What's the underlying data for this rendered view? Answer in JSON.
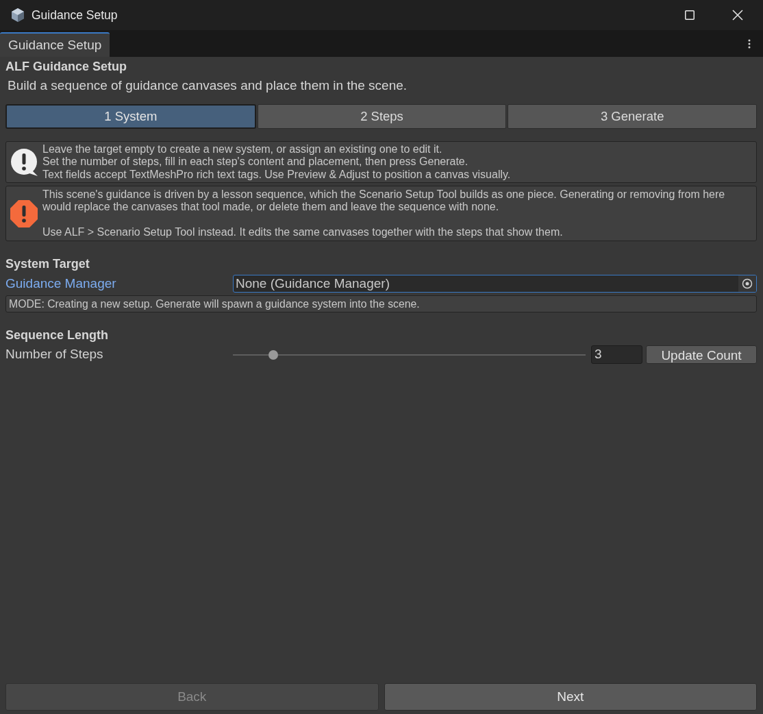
{
  "window": {
    "title": "Guidance Setup"
  },
  "tabs": [
    {
      "label": "Guidance Setup",
      "selected": true
    }
  ],
  "header": {
    "title": "ALF Guidance Setup",
    "subtitle": "Build a sequence of guidance canvases and place them in the scene."
  },
  "steps": [
    {
      "label": "1 System",
      "selected": true
    },
    {
      "label": "2 Steps",
      "selected": false
    },
    {
      "label": "3 Generate",
      "selected": false
    }
  ],
  "messages": [
    {
      "kind": "info",
      "paragraphs": [
        [
          "Leave the target empty to create a new system, or assign an existing one to edit it.",
          "Set the number of steps, fill in each step's content and placement, then press Generate.",
          "Text fields accept TextMeshPro rich text tags. Use Preview & Adjust to position a canvas visually."
        ]
      ]
    },
    {
      "kind": "warning",
      "paragraphs": [
        [
          "This scene's guidance is driven by a lesson sequence, which the Scenario Setup Tool builds as one piece. Generating or removing from here",
          "would replace the canvases that tool made, or delete them and leave the sequence with none."
        ],
        [
          "Use ALF > Scenario Setup Tool instead. It edits the same canvases together with the steps that show them."
        ]
      ]
    }
  ],
  "system_target": {
    "heading": "System Target",
    "field": {
      "label": "Guidance Manager",
      "value": "None (Guidance Manager)",
      "focused": true
    },
    "mode_note": "MODE: Creating a new setup. Generate will spawn a guidance system into the scene."
  },
  "sequence_length": {
    "heading": "Sequence Length",
    "label": "Number of Steps",
    "slider": {
      "level": 0.115
    },
    "value": "3",
    "button": "Update Count"
  },
  "footer": {
    "buttons": [
      {
        "label": "Back",
        "disabled": true
      },
      {
        "label": "Next",
        "disabled": false
      }
    ]
  }
}
